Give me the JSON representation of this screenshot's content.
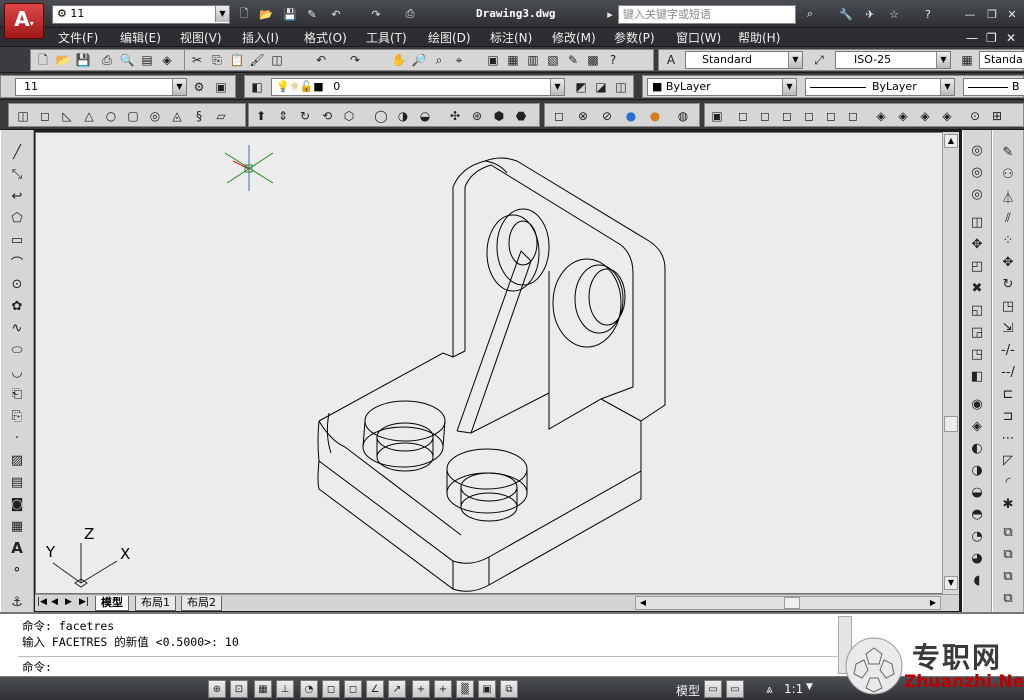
{
  "title_bar": {
    "workspace": "11",
    "file_name": "Drawing3.dwg",
    "search_placeholder": "键入关键字或短语"
  },
  "menu": [
    "文件(F)",
    "编辑(E)",
    "视图(V)",
    "插入(I)",
    "格式(O)",
    "工具(T)",
    "绘图(D)",
    "标注(N)",
    "修改(M)",
    "参数(P)",
    "窗口(W)",
    "帮助(H)"
  ],
  "toolbar_styles": {
    "text_style": "Standard",
    "dim_style": "ISO-25",
    "table_style": "Standa"
  },
  "layers_bar": {
    "workspace": "11",
    "layer": "0",
    "color": "ByLayer",
    "linetype": "ByLayer",
    "lineweight": "B"
  },
  "tabs": [
    "模型",
    "布局1",
    "布局2"
  ],
  "ucs": {
    "x": "X",
    "y": "Y",
    "z": "Z"
  },
  "command": {
    "line1": "命令: facetres",
    "line2": "输入 FACETRES 的新值 <0.5000>: 10",
    "prompt": "命令:"
  },
  "status": {
    "model": "模型",
    "scale": "1:1"
  },
  "watermark": {
    "cn": "专职网",
    "en": "Zhuanzhi.Net"
  }
}
